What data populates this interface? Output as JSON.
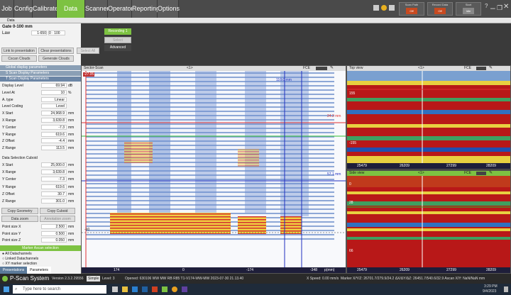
{
  "menu": {
    "tabs": [
      "Job",
      "Config",
      "Calibrate",
      "Data View",
      "Scanner",
      "Operator",
      "Reporting",
      "Options"
    ],
    "active": "Data View"
  },
  "header_controls": {
    "scan_path": {
      "label": "Scan Path",
      "value": "Off"
    },
    "record_data": {
      "label": "Record Data",
      "value": "Off"
    },
    "start": {
      "label": "Start",
      "value": "Idle"
    }
  },
  "window_controls": [
    "?",
    "–",
    "❐",
    "✕"
  ],
  "databar": {
    "title": "Data"
  },
  "gate": {
    "title": "Gate 0-100 mm",
    "law_label": "Law",
    "law_min": "1-650",
    "law_sep": "0 · 100"
  },
  "recording": {
    "title": "Recording 1",
    "select": "Select",
    "advanced": "Advanced"
  },
  "presentation": {
    "link": "Link to presentation",
    "clear": "Clear presentations",
    "select_all": "Select All",
    "cscan_clouds": "Cscan Clouds",
    "generate_clouds": "Generate Clouds"
  },
  "sections": {
    "global": "Global display parameters",
    "sscan": "S Scan Display Parameters",
    "tscan": "T Scan Display Parameters"
  },
  "params": [
    {
      "label": "Display Level",
      "value": "69.94",
      "unit": "dB"
    },
    {
      "label": "Level At",
      "value": "10",
      "unit": "%"
    },
    {
      "label": "A. type",
      "value": "Linear",
      "unit": ""
    },
    {
      "label": "Level Coding",
      "value": "Level",
      "unit": ""
    },
    {
      "label": "X Start",
      "value": "24,968.9",
      "unit": "mm"
    },
    {
      "label": "X Range",
      "value": "3,639.8",
      "unit": "mm"
    },
    {
      "label": "Y Center",
      "value": "-7.3",
      "unit": "mm"
    },
    {
      "label": "Y Range",
      "value": "619.6",
      "unit": "mm"
    },
    {
      "label": "Z Offset",
      "value": "-4.4",
      "unit": "mm"
    },
    {
      "label": "Z Range",
      "value": "113.5",
      "unit": "mm"
    }
  ],
  "cuboid_title": "Data Selection Cuboid",
  "cuboid": [
    {
      "label": "X Start",
      "value": "25,000.0",
      "unit": "mm"
    },
    {
      "label": "X Range",
      "value": "3,639.8",
      "unit": "mm"
    },
    {
      "label": "Y Center",
      "value": "-7.3",
      "unit": "mm"
    },
    {
      "label": "Y Range",
      "value": "619.6",
      "unit": "mm"
    },
    {
      "label": "Z Offset",
      "value": "30.7",
      "unit": "mm"
    },
    {
      "label": "Z Range",
      "value": "301.0",
      "unit": "mm"
    }
  ],
  "geom_buttons": {
    "copy_geometry": "Copy Geometry",
    "copy_cuboid": "Copy Cuboid",
    "data_zoom": "Data zoom",
    "annotation_zoom": "Annotation zoom"
  },
  "points": [
    {
      "label": "Point size X",
      "value": "2.500",
      "unit": "mm"
    },
    {
      "label": "Point size Y",
      "value": "0.500",
      "unit": "mm"
    },
    {
      "label": "Point size Z",
      "value": "0.050",
      "unit": "mm"
    }
  ],
  "marker_bar": "Marker Ascan selection",
  "radios": [
    "All Datachannels",
    "Linked Datachannels",
    "XY marker selection"
  ],
  "bottom_tabs": [
    "Presentations",
    "Parameters"
  ],
  "sector": {
    "title": "Sector-Scan",
    "mid": "<1>",
    "fce": "FCE",
    "depth_top": "110.0 mm",
    "depth_red": "24.2 mm",
    "depth_blue": "57.1 mm",
    "left_marker": "-27.05",
    "ticks": [
      "174",
      "0",
      "-174",
      "-348"
    ],
    "unit": "p(mm)",
    "y_mark": "-90"
  },
  "topview": {
    "title": "Top view",
    "mid": "<1>",
    "fce": "FCE",
    "ticks": [
      "25479",
      "26209",
      "27299",
      "28209"
    ],
    "ymarks": [
      "155",
      "-155"
    ]
  },
  "sideview": {
    "title": "Side view",
    "mid": "<1>",
    "fce": "FCE",
    "ticks": [
      "25479",
      "26209",
      "27299",
      "28209"
    ],
    "ymarks": [
      "0",
      "28",
      "66"
    ]
  },
  "status": {
    "app": "P-Scan System",
    "version": "Version 2.3.2.29556",
    "mode": "Simple",
    "level": "Level: 3",
    "opened": "Opened: 630106 WW MW RB R85 T1-V174-WW-MW 2023-07-30 21.13.40",
    "speed": "X Speed: 0.00 mm/s",
    "marker": "Marker X/Y/Z: 26701.7/279.9/24.2  ΔX/ΔY/ΔZ: 26451.7/540.6/32.9  Ascan X/Y: NaN/NaN mm"
  },
  "taskbar": {
    "search": "Type here to search",
    "time": "3:29 PM",
    "date": "9/4/2023"
  }
}
